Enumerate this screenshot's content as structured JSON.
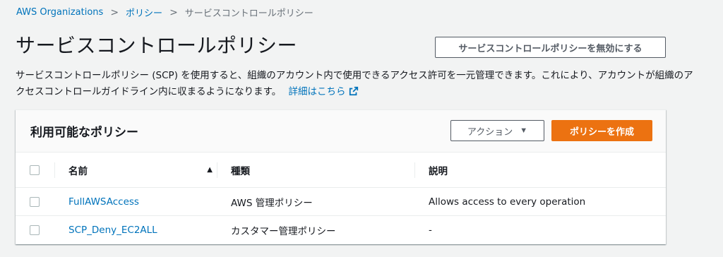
{
  "breadcrumb": {
    "items": [
      "AWS Organizations",
      "ポリシー"
    ],
    "current": "サービスコントロールポリシー",
    "separator": ">"
  },
  "page": {
    "title": "サービスコントロールポリシー",
    "disable_button": "サービスコントロールポリシーを無効にする",
    "description": "サービスコントロールポリシー (SCP) を使用すると、組織のアカウント内で使用できるアクセス許可を一元管理できます。これにより、アカウントが組織のアクセスコントロールガイドライン内に収まるようになります。",
    "learn_more": "詳細はこちら"
  },
  "panel": {
    "title": "利用可能なポリシー",
    "actions_button": "アクション",
    "create_button": "ポリシーを作成",
    "columns": [
      "名前",
      "種類",
      "説明"
    ],
    "rows": [
      {
        "name": "FullAWSAccess",
        "type": "AWS 管理ポリシー",
        "description": "Allows access to every operation"
      },
      {
        "name": "SCP_Deny_EC2ALL",
        "type": "カスタマー管理ポリシー",
        "description": "-"
      }
    ]
  },
  "colors": {
    "link": "#0073bb",
    "primary_button": "#ec7211",
    "background": "#f2f3f3"
  }
}
